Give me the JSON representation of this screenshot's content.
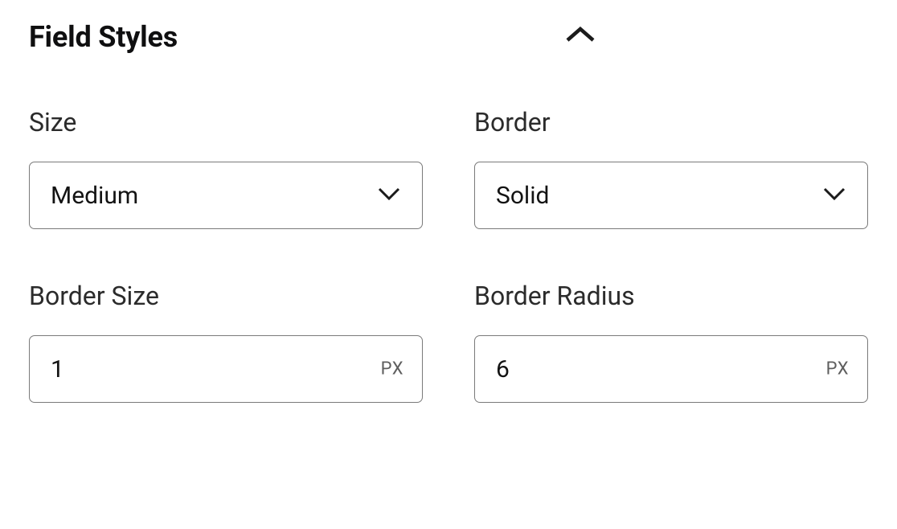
{
  "section": {
    "title": "Field Styles"
  },
  "fields": {
    "size": {
      "label": "Size",
      "value": "Medium"
    },
    "border": {
      "label": "Border",
      "value": "Solid"
    },
    "border_size": {
      "label": "Border Size",
      "value": "1",
      "unit": "PX"
    },
    "border_radius": {
      "label": "Border Radius",
      "value": "6",
      "unit": "PX"
    }
  }
}
